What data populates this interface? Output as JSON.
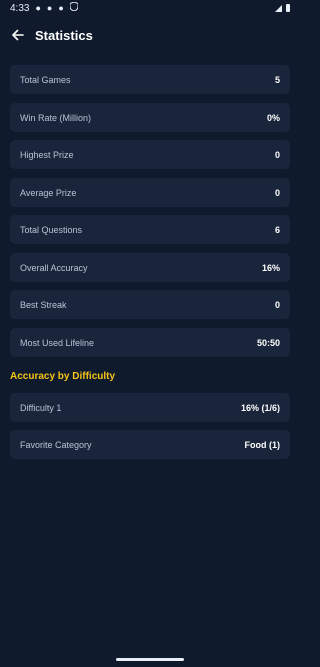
{
  "status_bar": {
    "time": "4:33",
    "icons": [
      "notification-dot-icon",
      "notification-dot-icon",
      "notification-dot-icon",
      "shield-icon",
      "signal-icon",
      "battery-icon"
    ]
  },
  "app_bar": {
    "title": "Statistics",
    "back_icon": "arrow-left-icon"
  },
  "stats": [
    {
      "label": "Total Games",
      "value": "5"
    },
    {
      "label": "Win Rate (Million)",
      "value": "0%"
    },
    {
      "label": "Highest Prize",
      "value": "0"
    },
    {
      "label": "Average Prize",
      "value": "0"
    },
    {
      "label": "Total Questions",
      "value": "6"
    },
    {
      "label": "Overall Accuracy",
      "value": "16%"
    },
    {
      "label": "Best Streak",
      "value": "0"
    },
    {
      "label": "Most Used Lifeline",
      "value": "50:50"
    }
  ],
  "difficulty_section": {
    "heading": "Accuracy by Difficulty",
    "rows": [
      {
        "label": "Difficulty 1",
        "value": "16% (1/6)"
      },
      {
        "label": "Favorite Category",
        "value": "Food (1)"
      }
    ]
  },
  "colors": {
    "background": "#0f1a2c",
    "card": "#19253a",
    "accent": "#f5c518",
    "text": "#ffffff",
    "muted_text": "#b9c4d4"
  }
}
